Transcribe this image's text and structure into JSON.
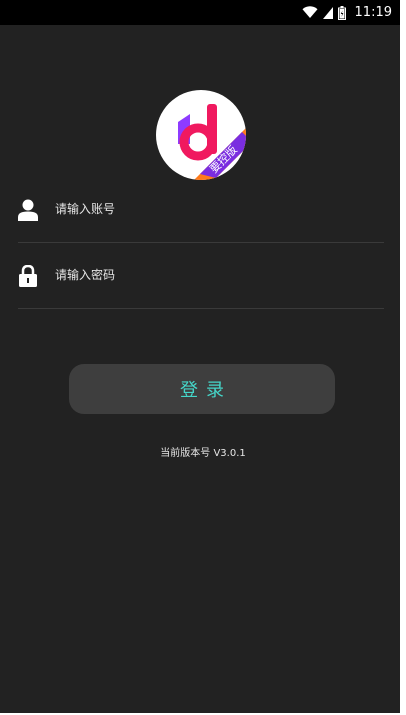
{
  "status_bar": {
    "time": "11:19",
    "icons": [
      "wifi-icon",
      "signal-icon",
      "battery-icon"
    ]
  },
  "logo": {
    "badge_text": "要控版",
    "colors": {
      "pink": "#f0195f",
      "purple": "#8e3bff",
      "badge": "#7a2de0",
      "orange": "#ff7a1a"
    }
  },
  "form": {
    "username_placeholder": "请输入账号",
    "password_placeholder": "请输入密码",
    "username_icon": "user-icon",
    "password_icon": "lock-icon"
  },
  "login_button": {
    "label": "登录"
  },
  "version_text": "当前版本号 V3.0.1",
  "colors": {
    "background": "#222222",
    "button_bg": "#3e3e3e",
    "button_text": "#45d6c9",
    "divider": "#3a3a3a"
  }
}
